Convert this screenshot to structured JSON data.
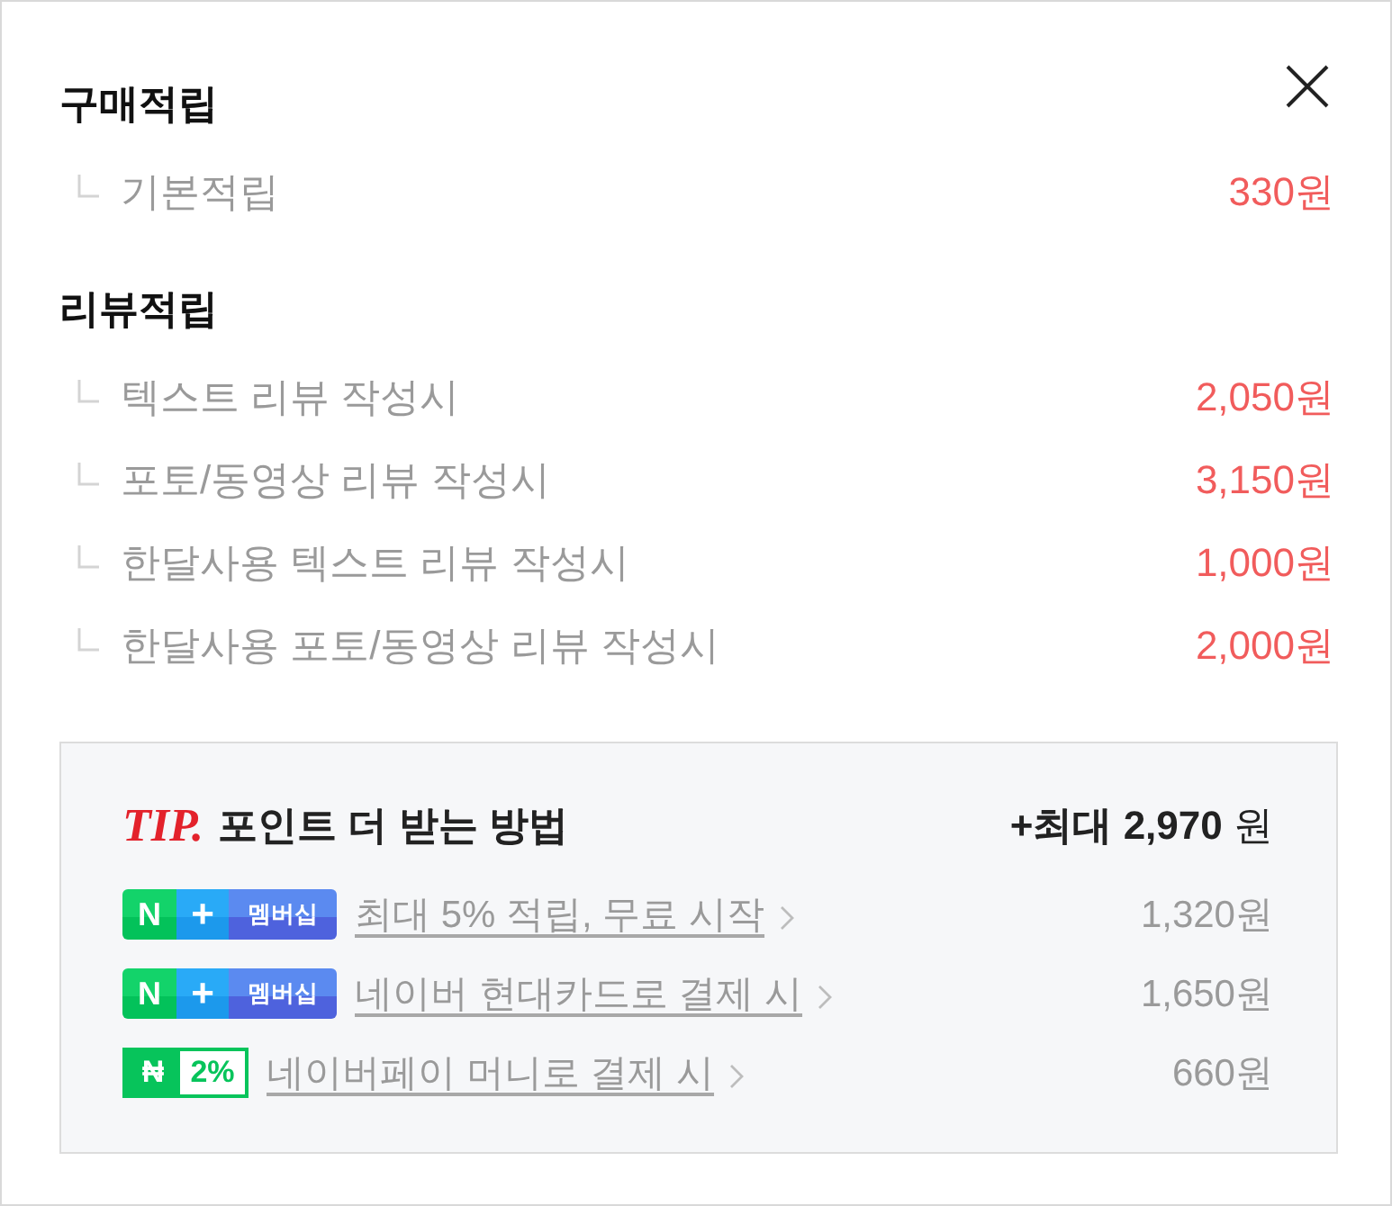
{
  "sections": [
    {
      "title": "구매적립",
      "items": [
        {
          "label": "기본적립",
          "amount": "330원"
        }
      ]
    },
    {
      "title": "리뷰적립",
      "items": [
        {
          "label": "텍스트 리뷰 작성시",
          "amount": "2,050원"
        },
        {
          "label": "포토/동영상 리뷰 작성시",
          "amount": "3,150원"
        },
        {
          "label": "한달사용 텍스트 리뷰 작성시",
          "amount": "1,000원"
        },
        {
          "label": "한달사용 포토/동영상 리뷰 작성시",
          "amount": "2,000원"
        }
      ]
    }
  ],
  "tip": {
    "label": "TIP.",
    "title": "포인트 더 받는 방법",
    "total": "**+최대 2,970** 원",
    "offers": [
      {
        "kind": "membership",
        "badge": [
          "N",
          "+",
          "멤버십"
        ],
        "link": "최대 5% 적립, 무료 시작",
        "amount": "1,320원"
      },
      {
        "kind": "membership",
        "badge": [
          "N",
          "+",
          "멤버십"
        ],
        "link": "네이버 현대카드로 결제 시",
        "amount": "1,650원"
      },
      {
        "kind": "pay",
        "badge": [
          "₦",
          "2%"
        ],
        "link": "네이버페이 머니로 결제 시",
        "amount": "660원"
      }
    ]
  }
}
